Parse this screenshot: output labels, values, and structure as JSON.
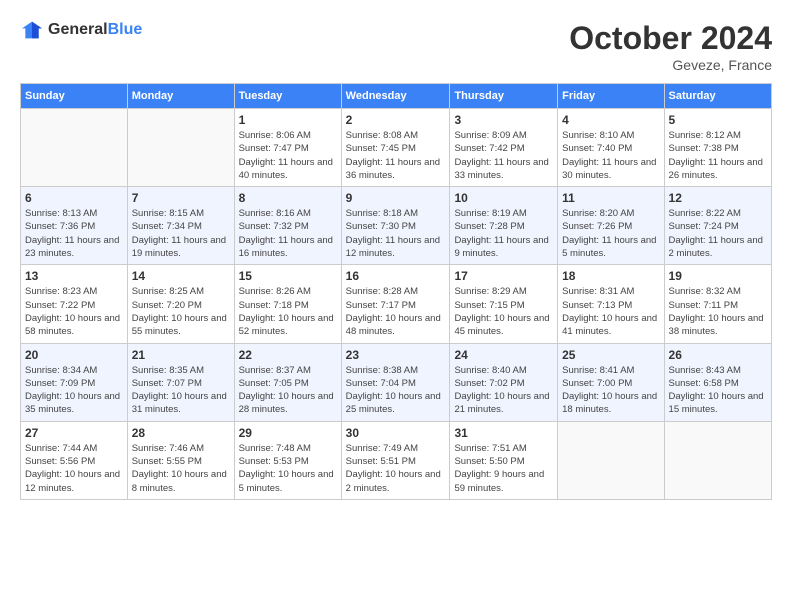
{
  "header": {
    "logo_general": "General",
    "logo_blue": "Blue",
    "month": "October 2024",
    "location": "Geveze, France"
  },
  "days_of_week": [
    "Sunday",
    "Monday",
    "Tuesday",
    "Wednesday",
    "Thursday",
    "Friday",
    "Saturday"
  ],
  "weeks": [
    [
      {
        "day": "",
        "info": ""
      },
      {
        "day": "",
        "info": ""
      },
      {
        "day": "1",
        "info": "Sunrise: 8:06 AM\nSunset: 7:47 PM\nDaylight: 11 hours and 40 minutes."
      },
      {
        "day": "2",
        "info": "Sunrise: 8:08 AM\nSunset: 7:45 PM\nDaylight: 11 hours and 36 minutes."
      },
      {
        "day": "3",
        "info": "Sunrise: 8:09 AM\nSunset: 7:42 PM\nDaylight: 11 hours and 33 minutes."
      },
      {
        "day": "4",
        "info": "Sunrise: 8:10 AM\nSunset: 7:40 PM\nDaylight: 11 hours and 30 minutes."
      },
      {
        "day": "5",
        "info": "Sunrise: 8:12 AM\nSunset: 7:38 PM\nDaylight: 11 hours and 26 minutes."
      }
    ],
    [
      {
        "day": "6",
        "info": "Sunrise: 8:13 AM\nSunset: 7:36 PM\nDaylight: 11 hours and 23 minutes."
      },
      {
        "day": "7",
        "info": "Sunrise: 8:15 AM\nSunset: 7:34 PM\nDaylight: 11 hours and 19 minutes."
      },
      {
        "day": "8",
        "info": "Sunrise: 8:16 AM\nSunset: 7:32 PM\nDaylight: 11 hours and 16 minutes."
      },
      {
        "day": "9",
        "info": "Sunrise: 8:18 AM\nSunset: 7:30 PM\nDaylight: 11 hours and 12 minutes."
      },
      {
        "day": "10",
        "info": "Sunrise: 8:19 AM\nSunset: 7:28 PM\nDaylight: 11 hours and 9 minutes."
      },
      {
        "day": "11",
        "info": "Sunrise: 8:20 AM\nSunset: 7:26 PM\nDaylight: 11 hours and 5 minutes."
      },
      {
        "day": "12",
        "info": "Sunrise: 8:22 AM\nSunset: 7:24 PM\nDaylight: 11 hours and 2 minutes."
      }
    ],
    [
      {
        "day": "13",
        "info": "Sunrise: 8:23 AM\nSunset: 7:22 PM\nDaylight: 10 hours and 58 minutes."
      },
      {
        "day": "14",
        "info": "Sunrise: 8:25 AM\nSunset: 7:20 PM\nDaylight: 10 hours and 55 minutes."
      },
      {
        "day": "15",
        "info": "Sunrise: 8:26 AM\nSunset: 7:18 PM\nDaylight: 10 hours and 52 minutes."
      },
      {
        "day": "16",
        "info": "Sunrise: 8:28 AM\nSunset: 7:17 PM\nDaylight: 10 hours and 48 minutes."
      },
      {
        "day": "17",
        "info": "Sunrise: 8:29 AM\nSunset: 7:15 PM\nDaylight: 10 hours and 45 minutes."
      },
      {
        "day": "18",
        "info": "Sunrise: 8:31 AM\nSunset: 7:13 PM\nDaylight: 10 hours and 41 minutes."
      },
      {
        "day": "19",
        "info": "Sunrise: 8:32 AM\nSunset: 7:11 PM\nDaylight: 10 hours and 38 minutes."
      }
    ],
    [
      {
        "day": "20",
        "info": "Sunrise: 8:34 AM\nSunset: 7:09 PM\nDaylight: 10 hours and 35 minutes."
      },
      {
        "day": "21",
        "info": "Sunrise: 8:35 AM\nSunset: 7:07 PM\nDaylight: 10 hours and 31 minutes."
      },
      {
        "day": "22",
        "info": "Sunrise: 8:37 AM\nSunset: 7:05 PM\nDaylight: 10 hours and 28 minutes."
      },
      {
        "day": "23",
        "info": "Sunrise: 8:38 AM\nSunset: 7:04 PM\nDaylight: 10 hours and 25 minutes."
      },
      {
        "day": "24",
        "info": "Sunrise: 8:40 AM\nSunset: 7:02 PM\nDaylight: 10 hours and 21 minutes."
      },
      {
        "day": "25",
        "info": "Sunrise: 8:41 AM\nSunset: 7:00 PM\nDaylight: 10 hours and 18 minutes."
      },
      {
        "day": "26",
        "info": "Sunrise: 8:43 AM\nSunset: 6:58 PM\nDaylight: 10 hours and 15 minutes."
      }
    ],
    [
      {
        "day": "27",
        "info": "Sunrise: 7:44 AM\nSunset: 5:56 PM\nDaylight: 10 hours and 12 minutes."
      },
      {
        "day": "28",
        "info": "Sunrise: 7:46 AM\nSunset: 5:55 PM\nDaylight: 10 hours and 8 minutes."
      },
      {
        "day": "29",
        "info": "Sunrise: 7:48 AM\nSunset: 5:53 PM\nDaylight: 10 hours and 5 minutes."
      },
      {
        "day": "30",
        "info": "Sunrise: 7:49 AM\nSunset: 5:51 PM\nDaylight: 10 hours and 2 minutes."
      },
      {
        "day": "31",
        "info": "Sunrise: 7:51 AM\nSunset: 5:50 PM\nDaylight: 9 hours and 59 minutes."
      },
      {
        "day": "",
        "info": ""
      },
      {
        "day": "",
        "info": ""
      }
    ]
  ]
}
